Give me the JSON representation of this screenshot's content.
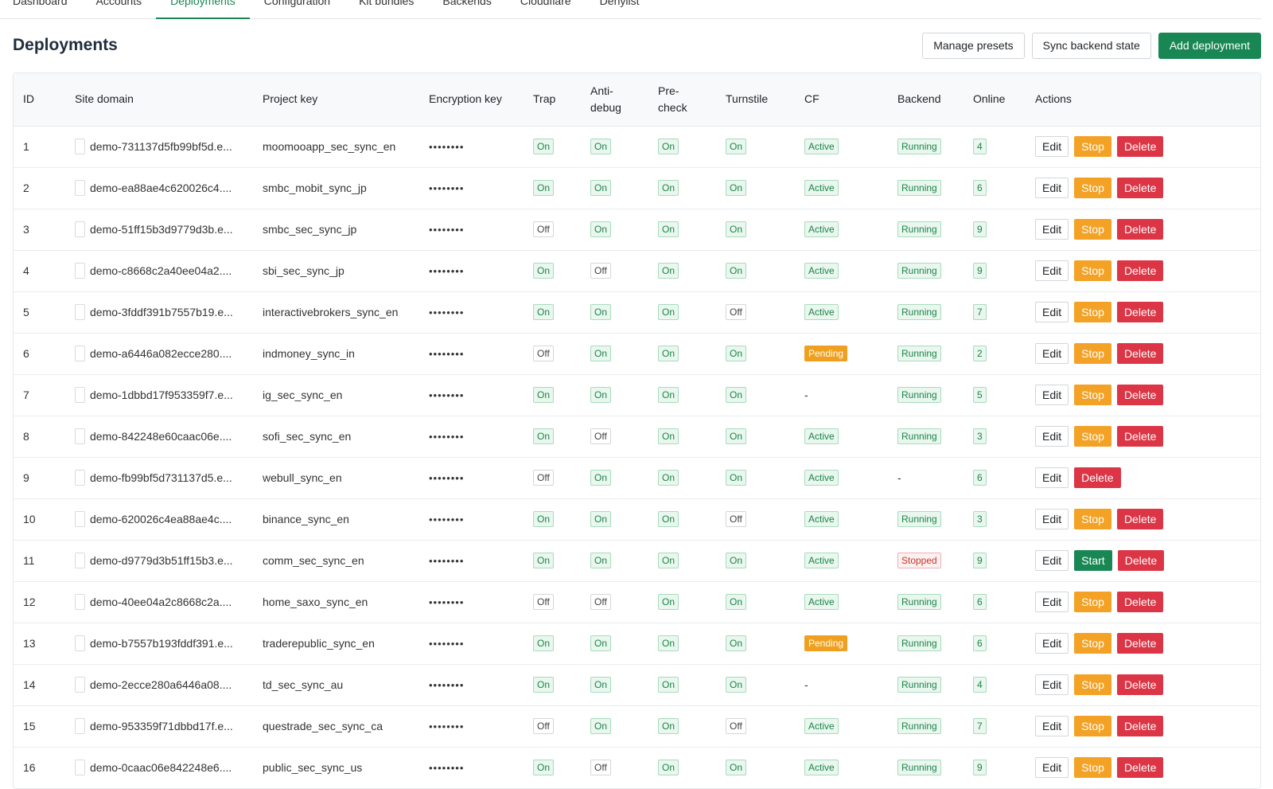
{
  "nav": {
    "tabs": [
      {
        "label": "Dashboard",
        "active": false
      },
      {
        "label": "Accounts",
        "active": false
      },
      {
        "label": "Deployments",
        "active": true
      },
      {
        "label": "Configuration",
        "active": false
      },
      {
        "label": "Kit bundles",
        "active": false
      },
      {
        "label": "Backends",
        "active": false
      },
      {
        "label": "Cloudflare",
        "active": false
      },
      {
        "label": "Denylist",
        "active": false
      }
    ]
  },
  "header": {
    "title": "Deployments",
    "manage_presets_label": "Manage presets",
    "sync_label": "Sync backend state",
    "add_label": "Add deployment"
  },
  "table": {
    "columns": [
      "ID",
      "Site domain",
      "Project key",
      "Encryption key",
      "Trap",
      "Anti-debug",
      "Pre-check",
      "Turnstile",
      "CF",
      "Backend",
      "Online",
      "Actions"
    ],
    "edit_label": "Edit",
    "delete_label": "Delete",
    "rows": [
      {
        "id": "1",
        "site": "demo-731137d5fb99bf5d.e...",
        "project": "moomooapp_sec_sync_en",
        "enc": "••••••••",
        "trap": "On",
        "anti": "On",
        "pre": "On",
        "turn": "On",
        "cf": "Active",
        "backend": "Running",
        "online": "4",
        "action": "Stop"
      },
      {
        "id": "2",
        "site": "demo-ea88ae4c620026c4....",
        "project": "smbc_mobit_sync_jp",
        "enc": "••••••••",
        "trap": "On",
        "anti": "On",
        "pre": "On",
        "turn": "On",
        "cf": "Active",
        "backend": "Running",
        "online": "6",
        "action": "Stop"
      },
      {
        "id": "3",
        "site": "demo-51ff15b3d9779d3b.e...",
        "project": "smbc_sec_sync_jp",
        "enc": "••••••••",
        "trap": "Off",
        "anti": "On",
        "pre": "On",
        "turn": "On",
        "cf": "Active",
        "backend": "Running",
        "online": "9",
        "action": "Stop"
      },
      {
        "id": "4",
        "site": "demo-c8668c2a40ee04a2....",
        "project": "sbi_sec_sync_jp",
        "enc": "••••••••",
        "trap": "On",
        "anti": "Off",
        "pre": "On",
        "turn": "On",
        "cf": "Active",
        "backend": "Running",
        "online": "9",
        "action": "Stop"
      },
      {
        "id": "5",
        "site": "demo-3fddf391b7557b19.e...",
        "project": "interactivebrokers_sync_en",
        "enc": "••••••••",
        "trap": "On",
        "anti": "On",
        "pre": "On",
        "turn": "Off",
        "cf": "Active",
        "backend": "Running",
        "online": "7",
        "action": "Stop"
      },
      {
        "id": "6",
        "site": "demo-a6446a082ecce280....",
        "project": "indmoney_sync_in",
        "enc": "••••••••",
        "trap": "Off",
        "anti": "On",
        "pre": "On",
        "turn": "On",
        "cf": "Pending",
        "backend": "Running",
        "online": "2",
        "action": "Stop"
      },
      {
        "id": "7",
        "site": "demo-1dbbd17f953359f7.e...",
        "project": "ig_sec_sync_en",
        "enc": "••••••••",
        "trap": "On",
        "anti": "On",
        "pre": "On",
        "turn": "On",
        "cf": "-",
        "backend": "Running",
        "online": "5",
        "action": "Stop"
      },
      {
        "id": "8",
        "site": "demo-842248e60caac06e....",
        "project": "sofi_sec_sync_en",
        "enc": "••••••••",
        "trap": "On",
        "anti": "Off",
        "pre": "On",
        "turn": "On",
        "cf": "Active",
        "backend": "Running",
        "online": "3",
        "action": "Stop"
      },
      {
        "id": "9",
        "site": "demo-fb99bf5d731137d5.e...",
        "project": "webull_sync_en",
        "enc": "••••••••",
        "trap": "Off",
        "anti": "On",
        "pre": "On",
        "turn": "On",
        "cf": "Active",
        "backend": "-",
        "online": "6",
        "action": ""
      },
      {
        "id": "10",
        "site": "demo-620026c4ea88ae4c....",
        "project": "binance_sync_en",
        "enc": "••••••••",
        "trap": "On",
        "anti": "On",
        "pre": "On",
        "turn": "Off",
        "cf": "Active",
        "backend": "Running",
        "online": "3",
        "action": "Stop"
      },
      {
        "id": "11",
        "site": "demo-d9779d3b51ff15b3.e...",
        "project": "comm_sec_sync_en",
        "enc": "••••••••",
        "trap": "On",
        "anti": "On",
        "pre": "On",
        "turn": "On",
        "cf": "Active",
        "backend": "Stopped",
        "online": "9",
        "action": "Start"
      },
      {
        "id": "12",
        "site": "demo-40ee04a2c8668c2a....",
        "project": "home_saxo_sync_en",
        "enc": "••••••••",
        "trap": "Off",
        "anti": "Off",
        "pre": "On",
        "turn": "On",
        "cf": "Active",
        "backend": "Running",
        "online": "6",
        "action": "Stop"
      },
      {
        "id": "13",
        "site": "demo-b7557b193fddf391.e...",
        "project": "traderepublic_sync_en",
        "enc": "••••••••",
        "trap": "On",
        "anti": "On",
        "pre": "On",
        "turn": "On",
        "cf": "Pending",
        "backend": "Running",
        "online": "6",
        "action": "Stop"
      },
      {
        "id": "14",
        "site": "demo-2ecce280a6446a08....",
        "project": "td_sec_sync_au",
        "enc": "••••••••",
        "trap": "On",
        "anti": "On",
        "pre": "On",
        "turn": "On",
        "cf": "-",
        "backend": "Running",
        "online": "4",
        "action": "Stop"
      },
      {
        "id": "15",
        "site": "demo-953359f71dbbd17f.e...",
        "project": "questrade_sec_sync_ca",
        "enc": "••••••••",
        "trap": "Off",
        "anti": "On",
        "pre": "On",
        "turn": "Off",
        "cf": "Active",
        "backend": "Running",
        "online": "7",
        "action": "Stop"
      },
      {
        "id": "16",
        "site": "demo-0caac06e842248e6....",
        "project": "public_sec_sync_us",
        "enc": "••••••••",
        "trap": "On",
        "anti": "Off",
        "pre": "On",
        "turn": "On",
        "cf": "Active",
        "backend": "Running",
        "online": "9",
        "action": "Stop"
      }
    ]
  }
}
